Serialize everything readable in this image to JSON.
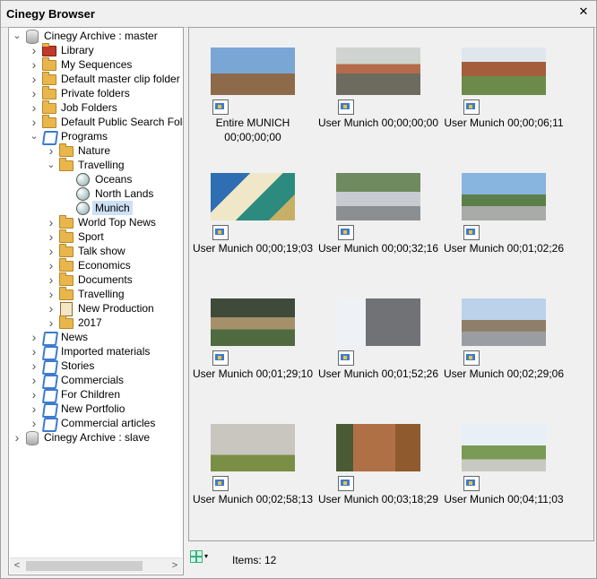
{
  "window": {
    "title": "Cinegy Browser",
    "close_glyph": "✕"
  },
  "tree": [
    {
      "label": "Cinegy Archive : master",
      "icon": "database-icon",
      "level": 0,
      "state": "expanded"
    },
    {
      "label": "Library",
      "icon": "library-icon",
      "level": 1,
      "state": "collapsed"
    },
    {
      "label": "My Sequences",
      "icon": "folder-icon",
      "level": 1,
      "state": "collapsed"
    },
    {
      "label": "Default master clip folder",
      "icon": "folder-icon",
      "level": 1,
      "state": "collapsed"
    },
    {
      "label": "Private folders",
      "icon": "folder-icon",
      "level": 1,
      "state": "collapsed"
    },
    {
      "label": "Job Folders",
      "icon": "job-folder-icon",
      "level": 1,
      "state": "collapsed"
    },
    {
      "label": "Default Public Search Folde",
      "icon": "search-folder-icon",
      "level": 1,
      "state": "collapsed"
    },
    {
      "label": "Programs",
      "icon": "blue-folder-icon",
      "level": 1,
      "state": "expanded"
    },
    {
      "label": "Nature",
      "icon": "folder-icon",
      "level": 2,
      "state": "collapsed"
    },
    {
      "label": "Travelling",
      "icon": "folder-icon",
      "level": 2,
      "state": "expanded"
    },
    {
      "label": "Oceans",
      "icon": "globe-icon",
      "level": 3,
      "state": "leaf"
    },
    {
      "label": "North Lands",
      "icon": "globe-icon",
      "level": 3,
      "state": "leaf"
    },
    {
      "label": "Munich",
      "icon": "globe-icon",
      "level": 3,
      "state": "leaf",
      "selected": true
    },
    {
      "label": "World Top News",
      "icon": "folder-icon",
      "level": 2,
      "state": "collapsed"
    },
    {
      "label": "Sport",
      "icon": "folder-icon",
      "level": 2,
      "state": "collapsed"
    },
    {
      "label": "Talk show",
      "icon": "folder-icon",
      "level": 2,
      "state": "collapsed"
    },
    {
      "label": "Economics",
      "icon": "folder-icon",
      "level": 2,
      "state": "collapsed"
    },
    {
      "label": "Documents",
      "icon": "folder-icon",
      "level": 2,
      "state": "collapsed"
    },
    {
      "label": "Travelling",
      "icon": "folder-icon",
      "level": 2,
      "state": "collapsed"
    },
    {
      "label": "New Production",
      "icon": "document-icon",
      "level": 2,
      "state": "collapsed"
    },
    {
      "label": "2017",
      "icon": "folder-icon",
      "level": 2,
      "state": "collapsed"
    },
    {
      "label": "News",
      "icon": "blue-folder-icon",
      "level": 1,
      "state": "collapsed"
    },
    {
      "label": "Imported materials",
      "icon": "blue-folder-icon",
      "level": 1,
      "state": "collapsed"
    },
    {
      "label": "Stories",
      "icon": "blue-folder-icon",
      "level": 1,
      "state": "collapsed"
    },
    {
      "label": "Commercials",
      "icon": "blue-folder-icon",
      "level": 1,
      "state": "collapsed"
    },
    {
      "label": "For Children",
      "icon": "blue-folder-icon",
      "level": 1,
      "state": "collapsed"
    },
    {
      "label": "New Portfolio",
      "icon": "blue-folder-icon",
      "level": 1,
      "state": "collapsed"
    },
    {
      "label": "Commercial articles",
      "icon": "blue-folder-icon",
      "level": 1,
      "state": "collapsed"
    },
    {
      "label": "Cinegy Archive : slave",
      "icon": "database-icon",
      "level": 0,
      "state": "collapsed"
    }
  ],
  "clips": [
    {
      "caption": "Entire MUNICH 00;00;00;00",
      "thumb": "tower-sky"
    },
    {
      "caption": "User Munich 00;00;00;00",
      "thumb": "market"
    },
    {
      "caption": "User Munich 00;00;06;11",
      "thumb": "square"
    },
    {
      "caption": "User Munich 00;00;19;03",
      "thumb": "crest"
    },
    {
      "caption": "User Munich 00;00;32;16",
      "thumb": "street"
    },
    {
      "caption": "User Munich 00;01;02;26",
      "thumb": "monument"
    },
    {
      "caption": "User Munich 00;01;29;10",
      "thumb": "stalls"
    },
    {
      "caption": "User Munich 00;01;52;26",
      "thumb": "clock"
    },
    {
      "caption": "User Munich 00;02;29;06",
      "thumb": "city-street"
    },
    {
      "caption": "User Munich 00;02;58;13",
      "thumb": "arch"
    },
    {
      "caption": "User Munich 00;03;18;29",
      "thumb": "musician"
    },
    {
      "caption": "User Munich 00;04;11;03",
      "thumb": "fountain"
    }
  ],
  "status": {
    "items_text": "Items: 12"
  },
  "scrollbar": {
    "left_glyph": "<",
    "right_glyph": ">"
  },
  "colors": {
    "selection": "#cde0f5",
    "panel_bg": "#f0f0f0",
    "tree_bg": "#ffffff"
  }
}
